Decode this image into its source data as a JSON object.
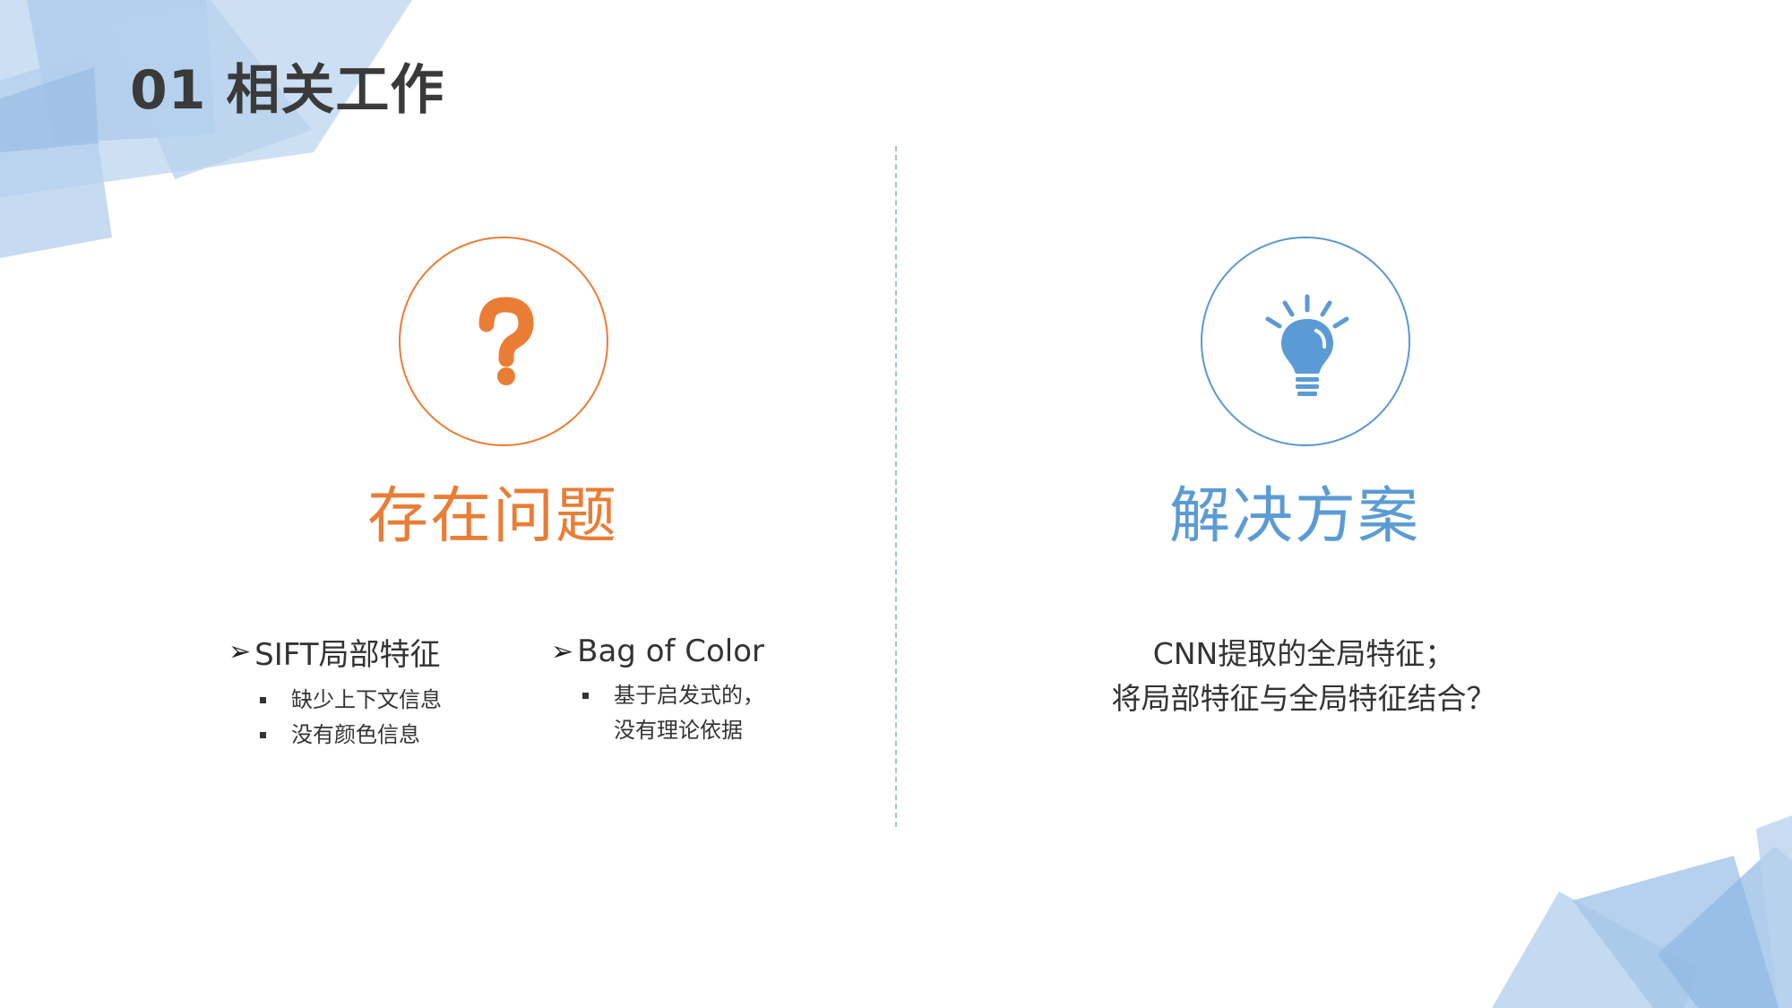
{
  "slide": {
    "title": "01 相关工作"
  },
  "colors": {
    "problem_accent": "#ea7d35",
    "solution_accent": "#5b9bd5",
    "decoration": "#a9c9ea"
  },
  "problem": {
    "icon": "question-mark-icon",
    "heading": "存在问题",
    "groups": [
      {
        "title": "SIFT局部特征",
        "items": [
          "缺少上下文信息",
          "没有颜色信息"
        ]
      },
      {
        "title": "Bag of Color",
        "items": [
          "基于启发式的，没有理论依据"
        ]
      }
    ]
  },
  "solution": {
    "icon": "lightbulb-icon",
    "heading": "解决方案",
    "lines": [
      "CNN提取的全局特征；",
      "将局部特征与全局特征结合？"
    ]
  }
}
